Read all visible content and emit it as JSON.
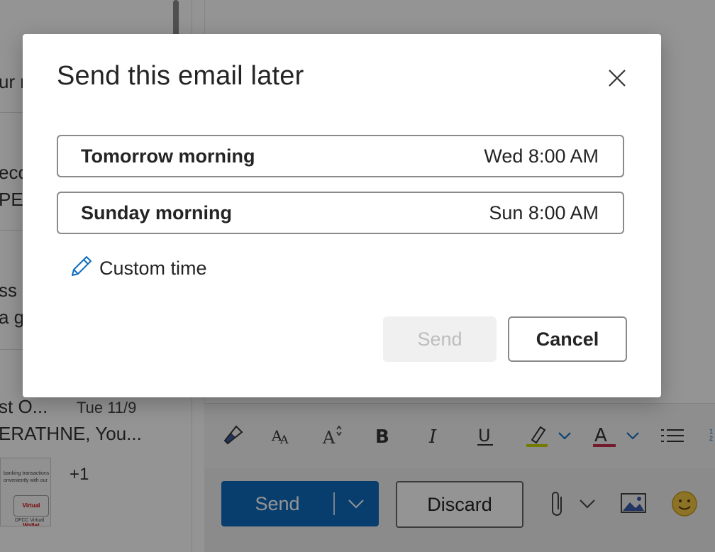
{
  "background": {
    "list": {
      "fragments": [
        "ur n",
        "eco",
        "PE",
        "ss",
        "a g"
      ],
      "last_item": {
        "sender": "st O...",
        "date": "Tue 11/9",
        "subject": "ERATHNE, You...",
        "extra": "+1",
        "thumb_lines": [
          "banking transactions",
          "onveniently with our"
        ],
        "thumb_badge": "Virtual Wallet",
        "thumb_caption": "DFCC Virtual"
      }
    },
    "compose": {
      "send_label": "Send",
      "discard_label": "Discard"
    }
  },
  "dialog": {
    "title": "Send this email later",
    "options": [
      {
        "name": "Tomorrow morning",
        "when": "Wed 8:00 AM"
      },
      {
        "name": "Sunday morning",
        "when": "Sun 8:00 AM"
      }
    ],
    "custom_label": "Custom time",
    "send_label": "Send",
    "cancel_label": "Cancel"
  },
  "colors": {
    "accent": "#0f6cbd",
    "highlight": "#c8d400",
    "font_color": "#c4314b"
  }
}
